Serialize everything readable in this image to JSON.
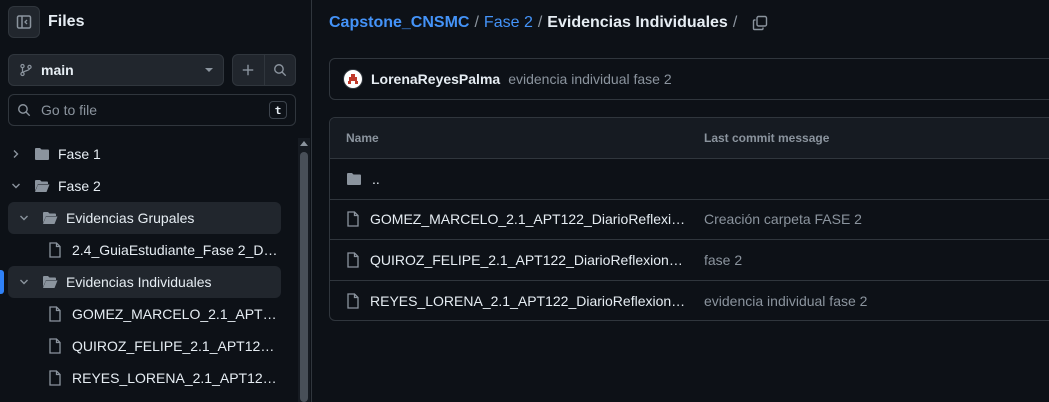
{
  "sidebar": {
    "title": "Files",
    "branch": "main",
    "search_placeholder": "Go to file",
    "search_shortcut": "t",
    "tree": [
      {
        "label": "Fase 1",
        "type": "folder",
        "expanded": false,
        "depth": 0
      },
      {
        "label": "Fase 2",
        "type": "folder",
        "expanded": true,
        "depth": 0
      },
      {
        "label": "Evidencias Grupales",
        "type": "folder",
        "expanded": true,
        "depth": 1
      },
      {
        "label": "2.4_GuiaEstudiante_Fase 2_Des...",
        "type": "file",
        "depth": 2
      },
      {
        "label": "Evidencias Individuales",
        "type": "folder",
        "expanded": true,
        "depth": 1,
        "active": true
      },
      {
        "label": "GOMEZ_MARCELO_2.1_APT12...",
        "type": "file",
        "depth": 2
      },
      {
        "label": "QUIROZ_FELIPE_2.1_APT122_D...",
        "type": "file",
        "depth": 2
      },
      {
        "label": "REYES_LORENA_2.1_APT122_D...",
        "type": "file",
        "depth": 2
      }
    ]
  },
  "breadcrumb": {
    "repo": "Capstone_CNSMC",
    "folder": "Fase 2",
    "current": "Evidencias Individuales",
    "sep": "/"
  },
  "latest_commit": {
    "author": "LorenaReyesPalma",
    "message": "evidencia individual fase 2"
  },
  "table": {
    "col_name": "Name",
    "col_message": "Last commit message",
    "parent": "..",
    "rows": [
      {
        "name": "GOMEZ_MARCELO_2.1_APT122_DiarioReflexionFa...",
        "message": "Creación carpeta FASE 2"
      },
      {
        "name": "QUIROZ_FELIPE_2.1_APT122_DiarioReflexionFase2...",
        "message": "fase 2"
      },
      {
        "name": "REYES_LORENA_2.1_APT122_DiarioReflexionFase2...",
        "message": "evidencia individual fase 2"
      }
    ]
  },
  "colors": {
    "background": "#0d1117",
    "link": "#4493f8",
    "border": "#30363d",
    "muted": "#8b949e",
    "active_marker": "#2f81f7"
  }
}
